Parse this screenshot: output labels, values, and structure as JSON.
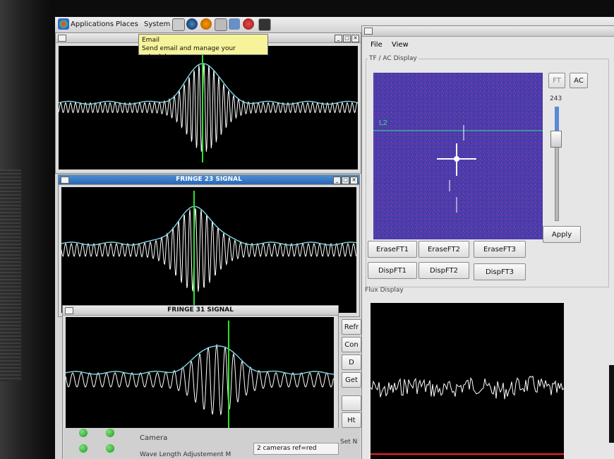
{
  "topbar": {
    "menus": [
      "Applications",
      "Places",
      "System"
    ]
  },
  "tooltip": {
    "title": "Email",
    "text": "Send email and manage your schedule"
  },
  "windows": {
    "fringe_top": {
      "title": ""
    },
    "fringe_23": {
      "title": "FRINGE 23 SIGNAL"
    },
    "fringe_31": {
      "title": "FRINGE 31 SIGNAL"
    }
  },
  "right_panel": {
    "menus": [
      "File",
      "View"
    ],
    "tf_title": "TF / AC Display",
    "line_label": "L2",
    "ft_button": "FT",
    "ac_button": "AC",
    "slider_value": "243",
    "apply_button": "Apply",
    "erase_buttons": [
      "EraseFT1",
      "EraseFT2",
      "EraseFT3"
    ],
    "disp_buttons": [
      "DispFT1",
      "DispFT2",
      "DispFT3"
    ],
    "flux_title": "Flux Display"
  },
  "side_buttons": [
    "Refr",
    "Con",
    "D",
    "Get",
    "",
    "Ht"
  ],
  "bottom": {
    "camera_label": "Camera",
    "cameras_value": "2 cameras ref=red",
    "wavelength_label": "Wave Length Adjustement M",
    "set_label": "Set N"
  },
  "colors": {
    "signal": "#ffffff",
    "envelope": "#7fd6e6",
    "marker": "#2ee02e",
    "tf_background": "#4b3ba8",
    "flux_baseline": "#ff2020"
  }
}
